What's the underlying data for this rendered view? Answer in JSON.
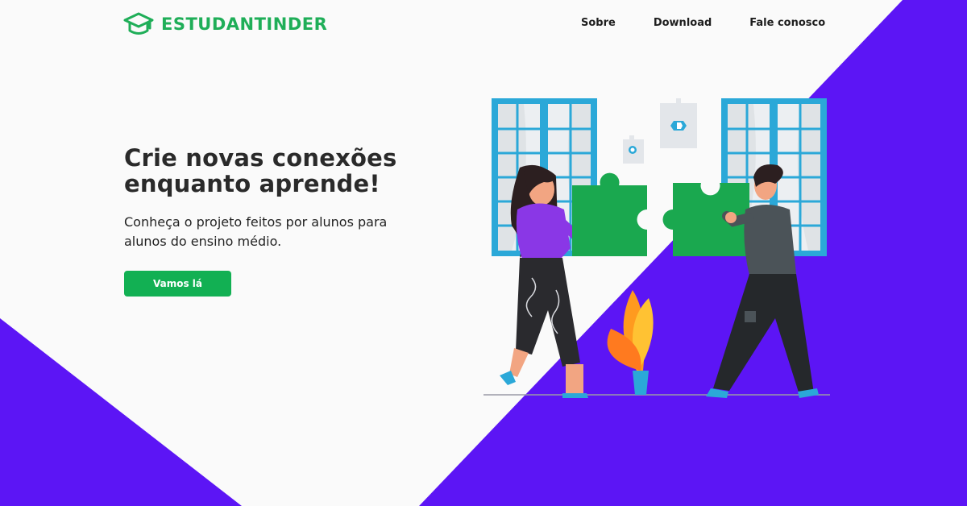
{
  "brand": {
    "name": "ESTUDANTINDER",
    "color": "#1fae58",
    "icon": "graduation-cap-icon"
  },
  "nav": {
    "items": [
      {
        "label": "Sobre"
      },
      {
        "label": "Download"
      },
      {
        "label": "Fale conosco"
      }
    ]
  },
  "hero": {
    "title_line1": "Crie novas conexões",
    "title_line2": "enquanto aprende!",
    "subtitle_line1": "Conheça o projeto feitos por alunos para",
    "subtitle_line2": "alunos do ensino médio.",
    "cta_label": "Vamos lá"
  },
  "colors": {
    "accent_purple": "#5c15f5",
    "cta_green": "#12b053",
    "puzzle_green": "#1aa84f",
    "window_blue": "#2ba8d8",
    "background": "#fafafa"
  }
}
